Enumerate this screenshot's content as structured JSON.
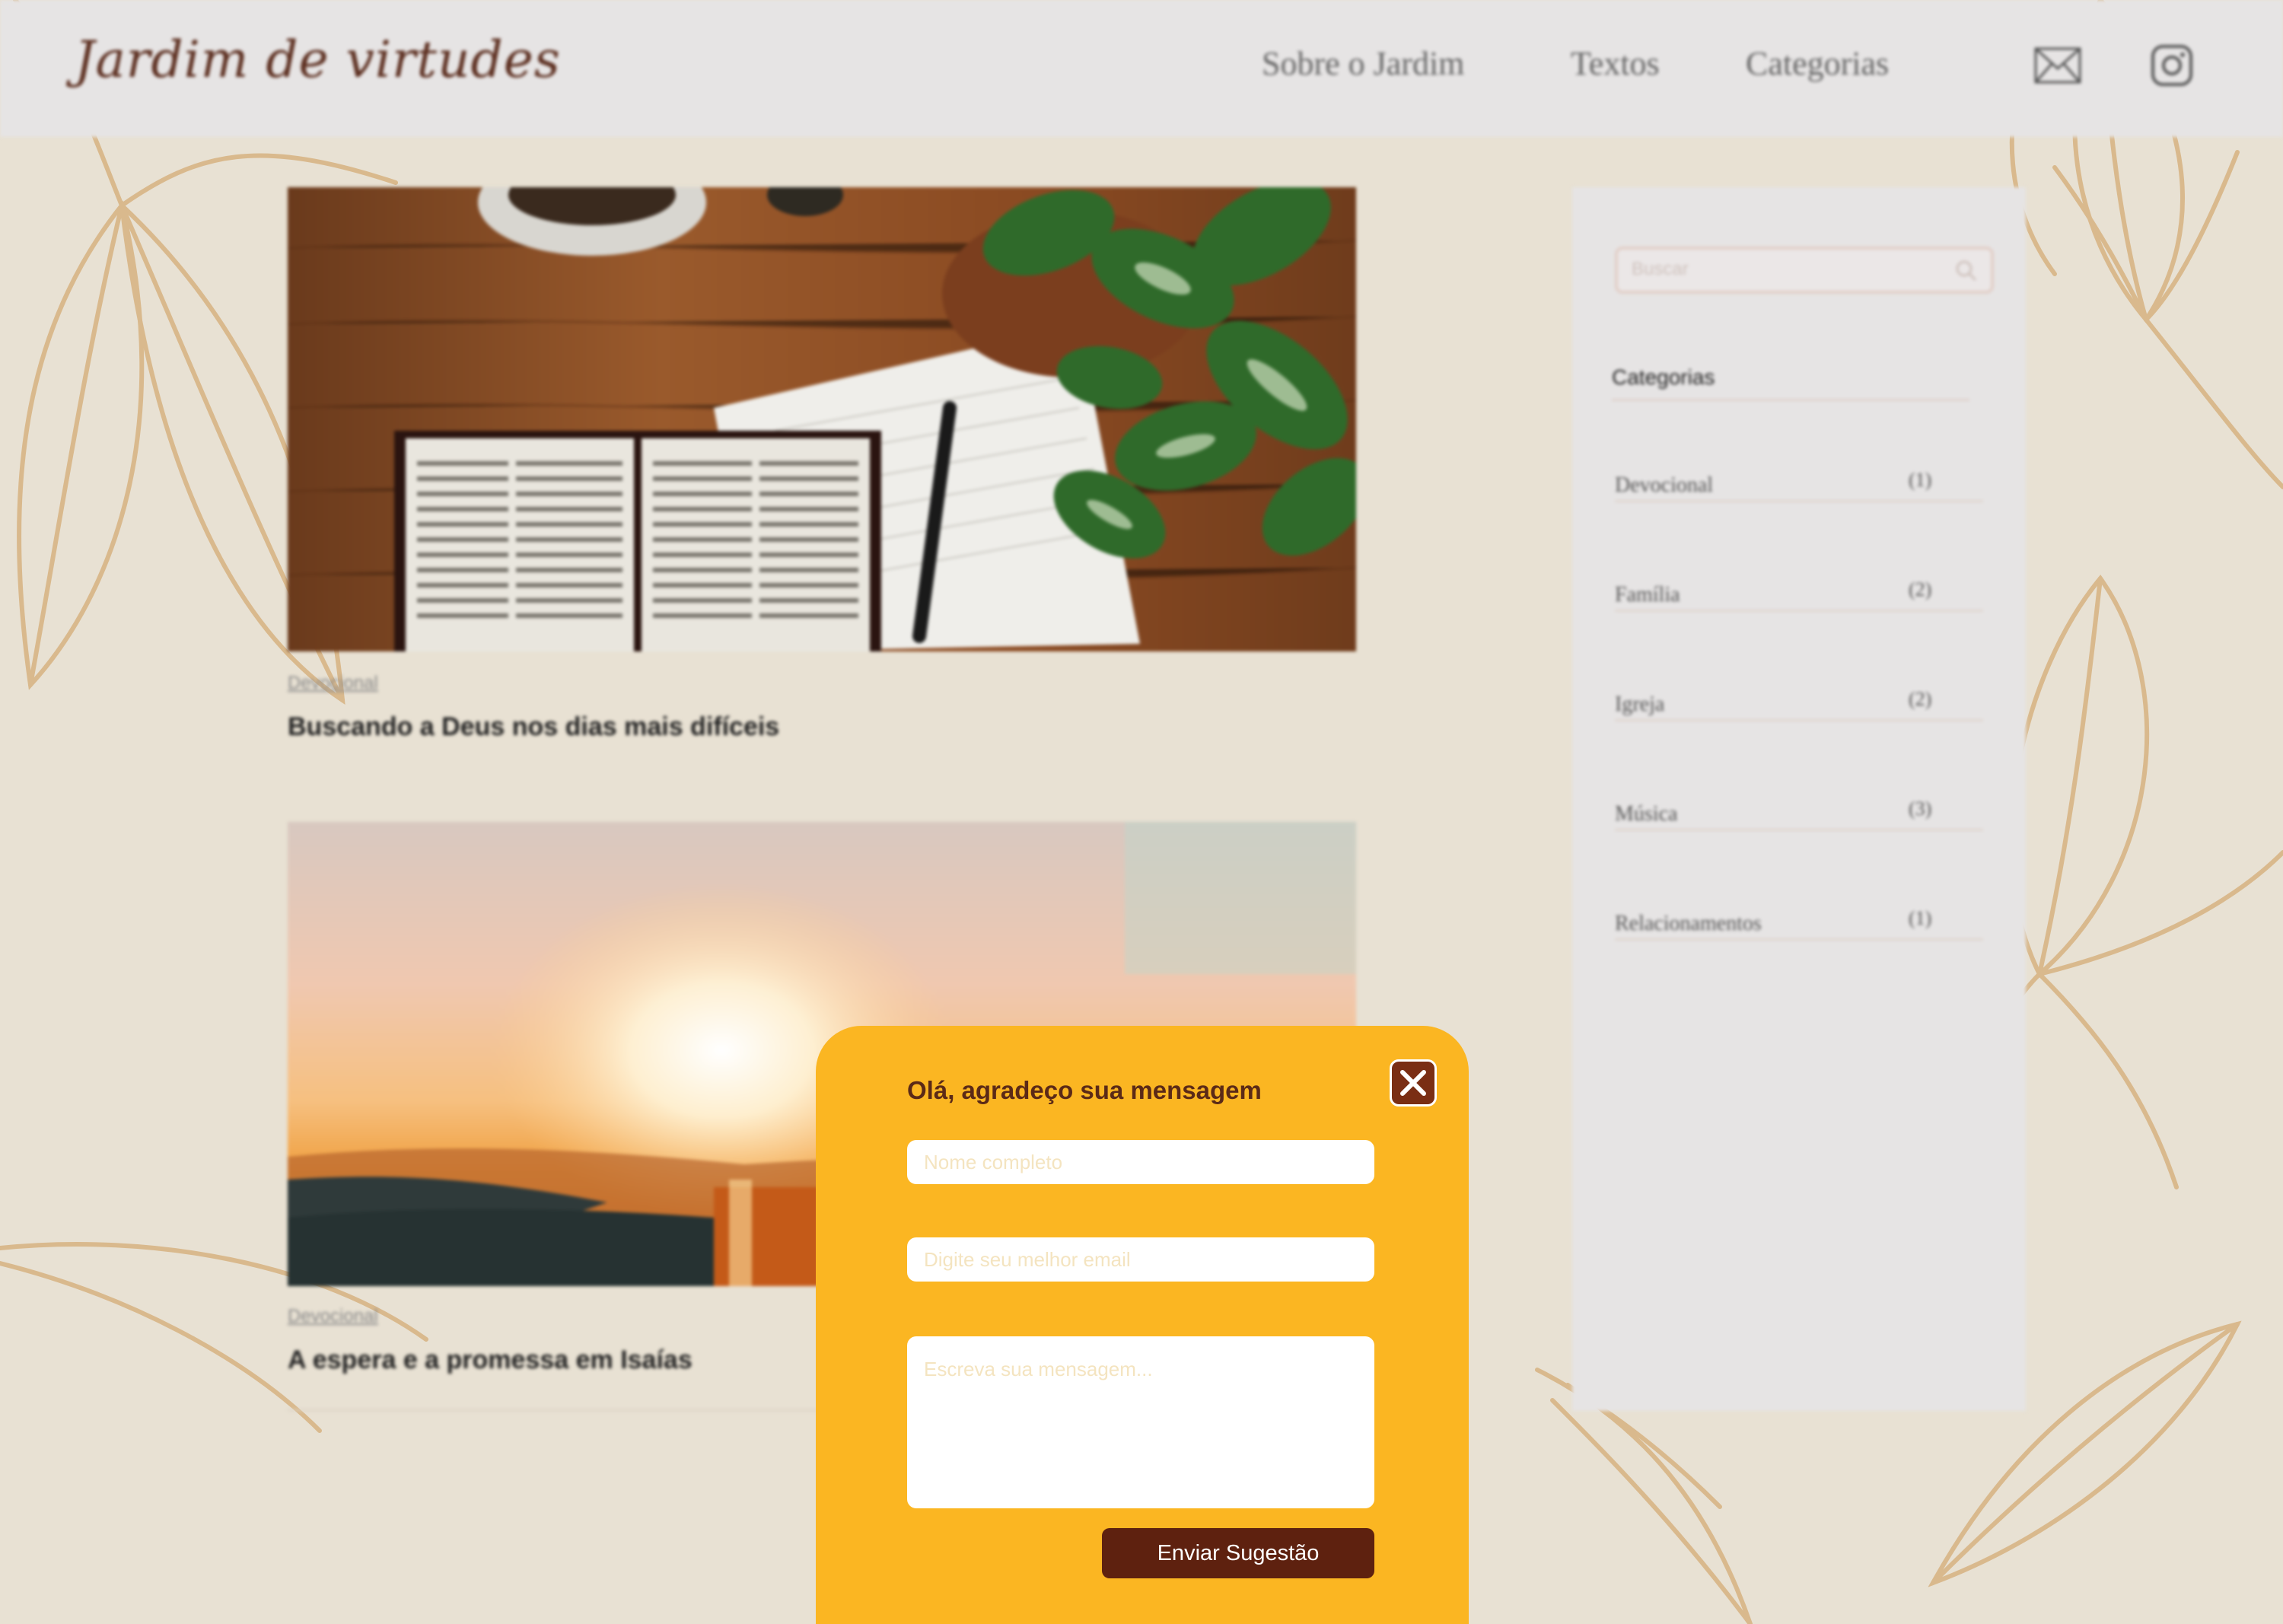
{
  "header": {
    "logo": "Jardim de virtudes",
    "nav": [
      "Sobre o Jardim",
      "Textos",
      "Categorias"
    ],
    "icons": [
      "mail-icon",
      "instagram-icon"
    ]
  },
  "posts": [
    {
      "category": "Devocional",
      "title": "Buscando a Deus nos dias mais difíceis"
    },
    {
      "category": "Devocional",
      "title": "A espera e a promessa em Isaías"
    }
  ],
  "sidebar": {
    "search_placeholder": "Buscar",
    "heading": "Categorias",
    "categories": [
      {
        "name": "Devocional",
        "count": "(1)"
      },
      {
        "name": "Família",
        "count": "(2)"
      },
      {
        "name": "Igreja",
        "count": "(2)"
      },
      {
        "name": "Música",
        "count": "(3)"
      },
      {
        "name": "Relacionamentos",
        "count": "(1)"
      }
    ]
  },
  "modal": {
    "title": "Olá, agradeço sua mensagem",
    "name_placeholder": "Nome completo",
    "email_placeholder": "Digite seu melhor email",
    "message_placeholder": "Escreva sua mensagem...",
    "submit_label": "Enviar Sugestão"
  },
  "colors": {
    "background": "#e8e1d3",
    "modal": "#fbb622",
    "accent_dark": "#5e210f",
    "leaf": "#d9b98d"
  }
}
